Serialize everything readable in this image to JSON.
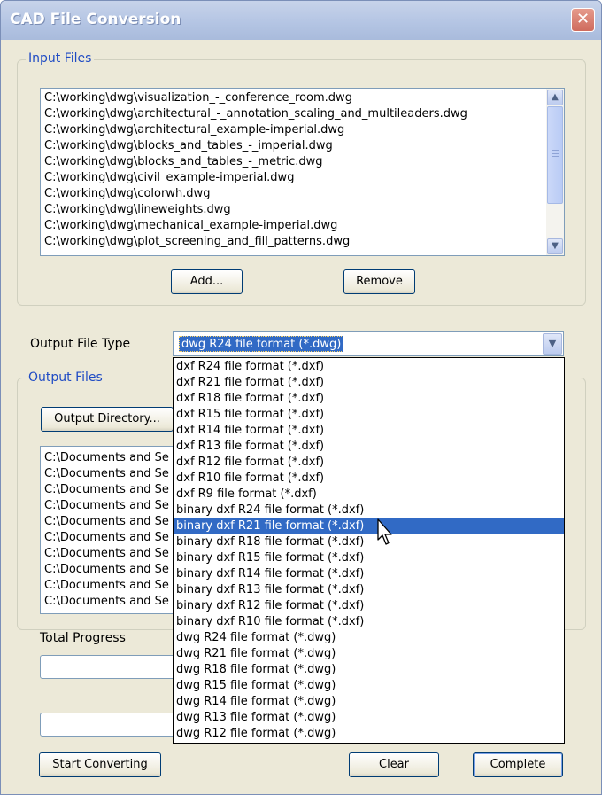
{
  "window": {
    "title": "CAD File Conversion",
    "close_icon": "close-icon"
  },
  "input_files": {
    "legend": "Input Files",
    "items": [
      "C:\\working\\dwg\\visualization_-_conference_room.dwg",
      "C:\\working\\dwg\\architectural_-_annotation_scaling_and_multileaders.dwg",
      "C:\\working\\dwg\\architectural_example-imperial.dwg",
      "C:\\working\\dwg\\blocks_and_tables_-_imperial.dwg",
      "C:\\working\\dwg\\blocks_and_tables_-_metric.dwg",
      "C:\\working\\dwg\\civil_example-imperial.dwg",
      "C:\\working\\dwg\\colorwh.dwg",
      "C:\\working\\dwg\\lineweights.dwg",
      "C:\\working\\dwg\\mechanical_example-imperial.dwg",
      "C:\\working\\dwg\\plot_screening_and_fill_patterns.dwg"
    ],
    "add_label": "Add...",
    "remove_label": "Remove"
  },
  "output_type": {
    "label": "Output File Type",
    "selected": "dwg R24 file format (*.dwg)",
    "options": [
      "dxf R24 file format (*.dxf)",
      "dxf R21 file format (*.dxf)",
      "dxf R18 file format (*.dxf)",
      "dxf R15 file format (*.dxf)",
      "dxf R14 file format (*.dxf)",
      "dxf R13 file format (*.dxf)",
      "dxf R12 file format (*.dxf)",
      "dxf R10 file format (*.dxf)",
      "dxf R9 file format (*.dxf)",
      "binary dxf R24 file format (*.dxf)",
      "binary dxf R21 file format (*.dxf)",
      "binary dxf R18 file format (*.dxf)",
      "binary dxf R15 file format (*.dxf)",
      "binary dxf R14 file format (*.dxf)",
      "binary dxf R13 file format (*.dxf)",
      "binary dxf R12 file format (*.dxf)",
      "binary dxf R10 file format (*.dxf)",
      "dwg R24 file format (*.dwg)",
      "dwg R21 file format (*.dwg)",
      "dwg R18 file format (*.dwg)",
      "dwg R15 file format (*.dwg)",
      "dwg R14 file format (*.dwg)",
      "dwg R13 file format (*.dwg)",
      "dwg R12 file format (*.dwg)"
    ],
    "highlighted_option": "binary dxf R21 file format (*.dxf)"
  },
  "output_files": {
    "legend": "Output Files",
    "directory_button": "Output Directory...",
    "items": [
      "C:\\Documents and Se",
      "C:\\Documents and Se",
      "C:\\Documents and Se",
      "C:\\Documents and Se",
      "C:\\Documents and Se",
      "C:\\Documents and Se",
      "C:\\Documents and Se",
      "C:\\Documents and Se",
      "C:\\Documents and Se",
      "C:\\Documents and Se"
    ]
  },
  "progress": {
    "total_label": "Total Progress"
  },
  "footer": {
    "start_label": "Start Converting",
    "clear_label": "Clear",
    "complete_label": "Complete"
  },
  "colors": {
    "window_bg": "#ece9d8",
    "legend_text": "#1f4bc4",
    "selection": "#316ac5"
  }
}
